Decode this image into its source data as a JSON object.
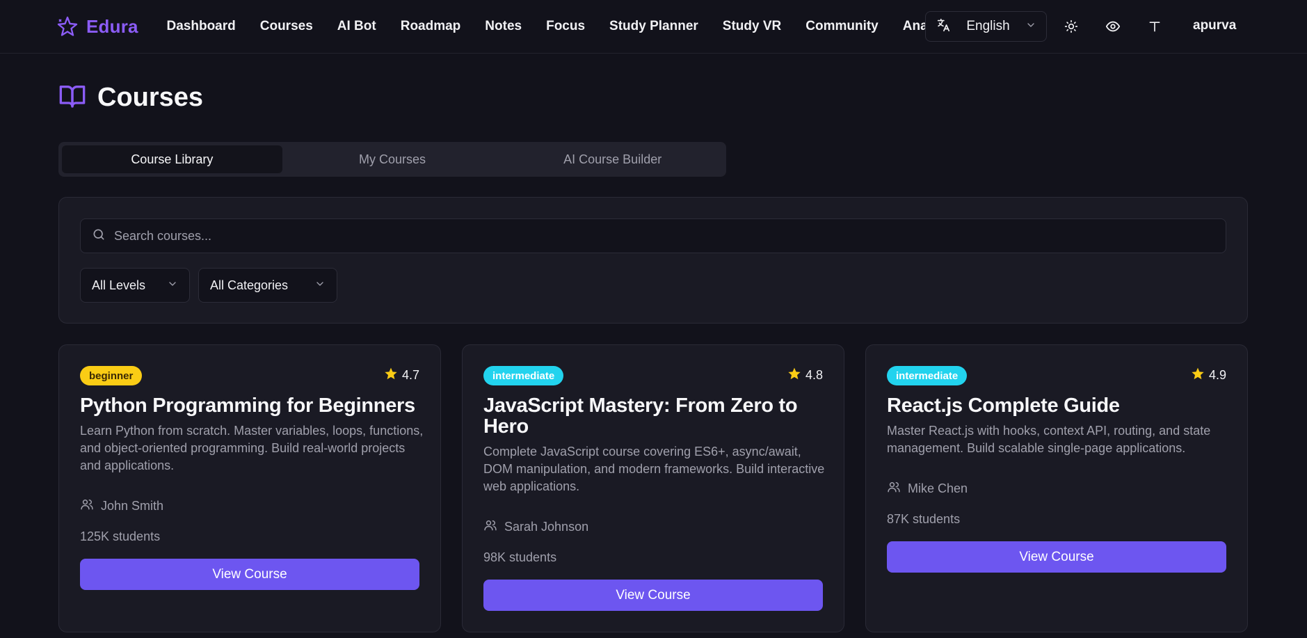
{
  "app": {
    "brand": "Edura",
    "accent": "#8b5cf6",
    "button_color": "#6d56f0"
  },
  "nav": {
    "items": [
      {
        "label": "Dashboard"
      },
      {
        "label": "Courses"
      },
      {
        "label": "AI Bot"
      },
      {
        "label": "Roadmap"
      },
      {
        "label": "Notes"
      },
      {
        "label": "Focus"
      },
      {
        "label": "Study Planner"
      },
      {
        "label": "Study VR"
      },
      {
        "label": "Community"
      },
      {
        "label": "Analytics"
      }
    ],
    "language": "English",
    "icons": [
      "translate-icon",
      "sun-icon",
      "eye-icon",
      "text-size-icon"
    ],
    "user": "apurva"
  },
  "page": {
    "title": "Courses",
    "icon": "book-open-icon"
  },
  "tabs": [
    {
      "label": "Course Library",
      "active": true
    },
    {
      "label": "My Courses",
      "active": false
    },
    {
      "label": "AI Course Builder",
      "active": false
    }
  ],
  "filters": {
    "search_placeholder": "Search courses...",
    "level": "All Levels",
    "category": "All Categories"
  },
  "courses": [
    {
      "level": "beginner",
      "rating": "4.7",
      "title": "Python Programming for Beginners",
      "description": "Learn Python from scratch. Master variables, loops, functions, and object-oriented programming. Build real-world projects and applications.",
      "instructor": "John Smith",
      "students": "125K students",
      "button": "View Course"
    },
    {
      "level": "intermediate",
      "rating": "4.8",
      "title": "JavaScript Mastery: From Zero to Hero",
      "description": "Complete JavaScript course covering ES6+, async/await, DOM manipulation, and modern frameworks. Build interactive web applications.",
      "instructor": "Sarah Johnson",
      "students": "98K students",
      "button": "View Course"
    },
    {
      "level": "intermediate",
      "rating": "4.9",
      "title": "React.js Complete Guide",
      "description": "Master React.js with hooks, context API, routing, and state management. Build scalable single-page applications.",
      "instructor": "Mike Chen",
      "students": "87K students",
      "button": "View Course"
    }
  ]
}
